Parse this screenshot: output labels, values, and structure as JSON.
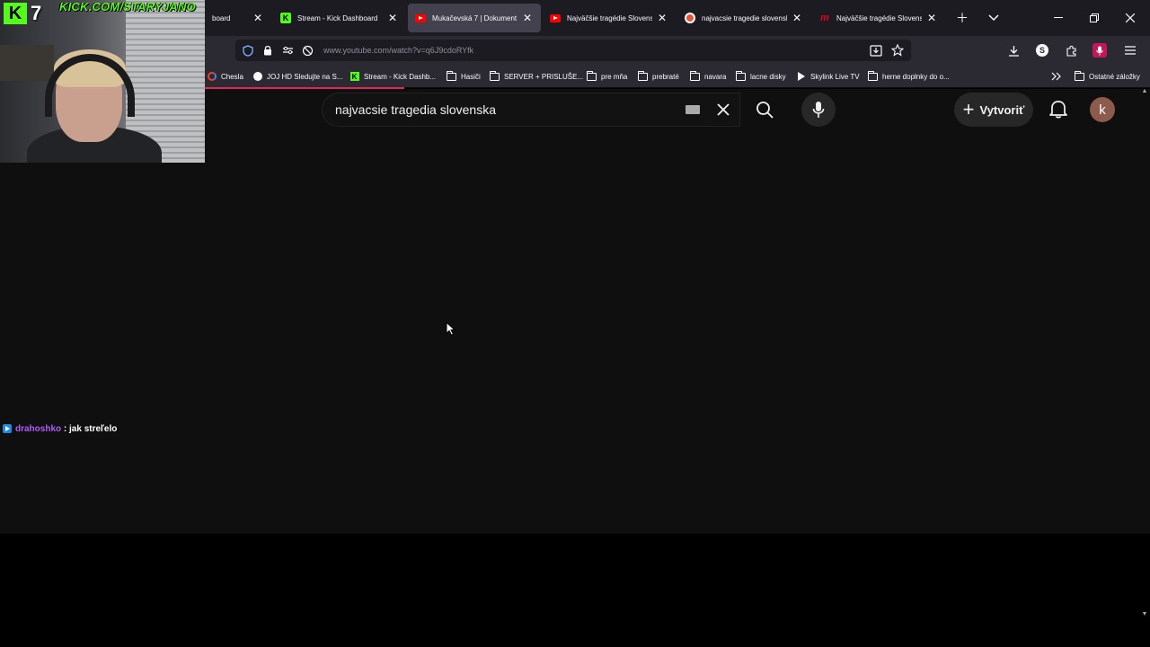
{
  "browser": {
    "tabs": [
      {
        "title": "board",
        "favicon": "kick-icon",
        "active": false
      },
      {
        "title": "Stream - Kick Dashboard",
        "favicon": "kick-icon",
        "active": false
      },
      {
        "title": "Mukačevská 7 | Dokument R",
        "favicon": "youtube-icon",
        "active": true
      },
      {
        "title": "Najväčšie tragédie Slovensk",
        "favicon": "youtube-icon",
        "active": false
      },
      {
        "title": "najvacsie tragedie slovensk",
        "favicon": "duckduckgo-icon",
        "active": false
      },
      {
        "title": "Najväčšie tragédie Slovensk",
        "favicon": "markiza-icon",
        "active": false
      }
    ],
    "url": "www.youtube.com/watch?v=q6J9cdoRYfk",
    "bookmarks": [
      {
        "label": "Chesla",
        "icon": "google-icon"
      },
      {
        "label": "JOJ HD Sledujte na S...",
        "icon": "joj-icon"
      },
      {
        "label": "Stream - Kick Dashb...",
        "icon": "kick-icon"
      },
      {
        "label": "Hasiči",
        "icon": "folder-icon"
      },
      {
        "label": "SERVER + PRISLUŠE...",
        "icon": "folder-icon"
      },
      {
        "label": "pre mňa",
        "icon": "folder-icon"
      },
      {
        "label": "prebraté",
        "icon": "folder-icon"
      },
      {
        "label": "navara",
        "icon": "folder-icon"
      },
      {
        "label": "lacne disky",
        "icon": "folder-icon"
      },
      {
        "label": "Skylink Live TV",
        "icon": "skylink-icon"
      },
      {
        "label": "herne doplnky do o...",
        "icon": "folder-icon"
      }
    ],
    "other_bookmarks": "Ostatné záložky",
    "profile_letter": "S"
  },
  "youtube": {
    "search_query": "najvacsie tragedia slovenska",
    "create_label": "Vytvoriť",
    "avatar_letter": "k"
  },
  "overlay": {
    "kick_number": "7",
    "kick_url": "KICK.COM/STARYJANO",
    "chat": {
      "user": "drahoshko",
      "separator": " : ",
      "message": "jak streľelo"
    }
  },
  "colors": {
    "kick_green": "#53fc18",
    "youtube_red": "#ff0000",
    "chat_user": "#b05cf7",
    "loading_bar": "#e02858"
  }
}
